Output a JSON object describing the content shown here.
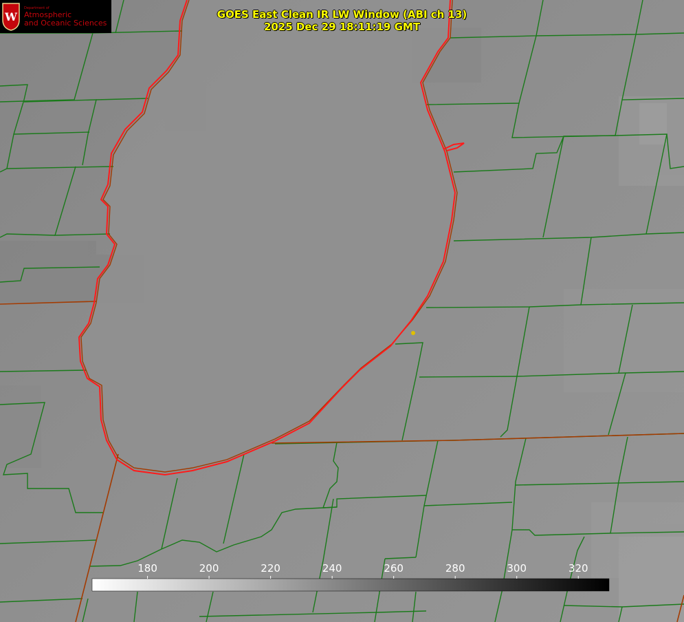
{
  "header": {
    "title_line1": "GOES East Clean IR LW Window (ABI ch 13)",
    "title_line2": "2025 Dec 29 18:11:19 GMT"
  },
  "logo": {
    "department_small": "Department of",
    "line1": "Atmospheric",
    "line2": "and Oceanic Sciences",
    "crest_letter": "W"
  },
  "colorbar": {
    "unit_min": 162,
    "unit_max": 330,
    "ticks": [
      "180",
      "200",
      "220",
      "240",
      "260",
      "280",
      "300",
      "320"
    ]
  },
  "colors": {
    "county_lines": "#1a7a1a",
    "state_lines": "#a33a00",
    "coastline": "#ff1a1a",
    "title_text": "#ffff00",
    "marker": "#e0c000"
  }
}
